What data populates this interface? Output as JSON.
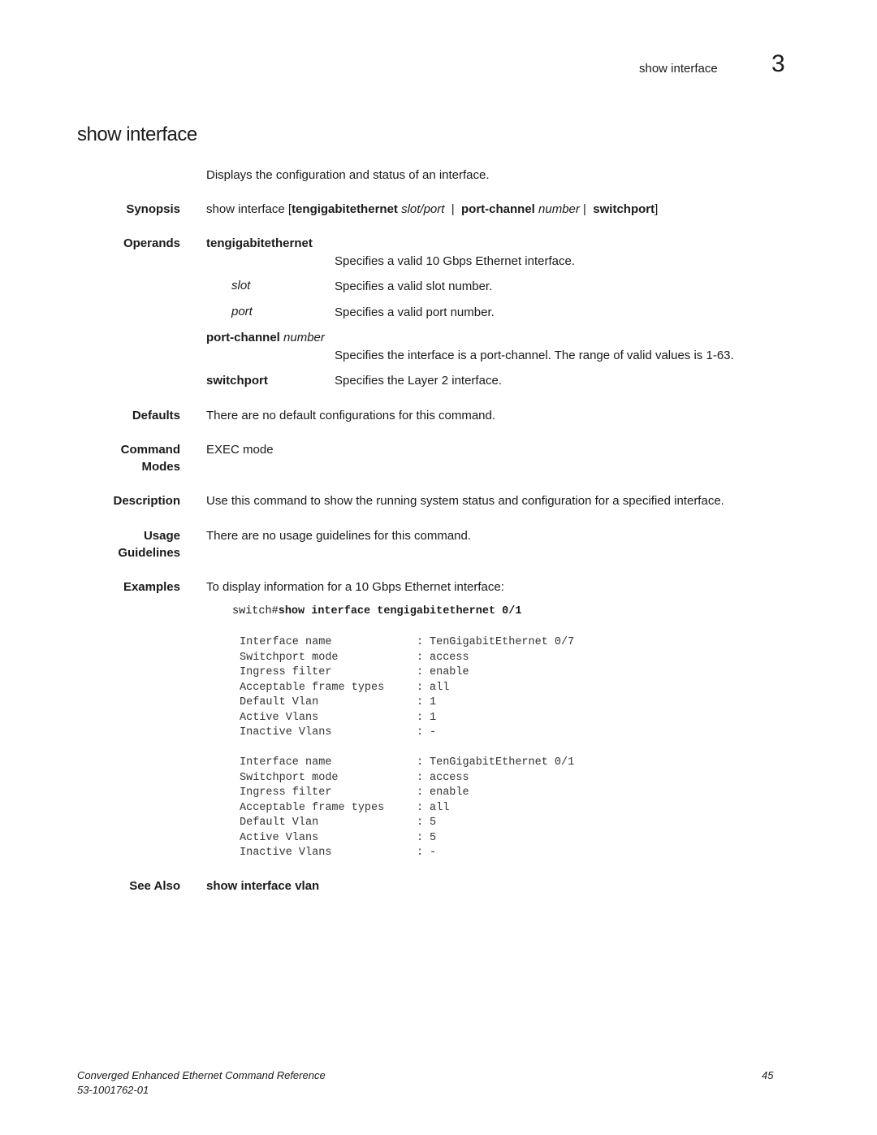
{
  "header": {
    "running_title": "show interface",
    "chapter_number": "3"
  },
  "title": "show interface",
  "intro": "Displays the configuration and status of an interface.",
  "synopsis": {
    "label": "Synopsis",
    "cmd": "show interface",
    "open": " [",
    "opt1": "tengigabitethernet",
    "opt1_arg": " slot/port",
    "sep1": "  |  ",
    "opt2": "port-channel",
    "opt2_arg": " number",
    "sep2": " |  ",
    "opt3": "switchport",
    "close": "]"
  },
  "operands": {
    "label": "Operands",
    "tengig": {
      "name": "tengigabitethernet",
      "desc": "Specifies a valid 10 Gbps Ethernet interface."
    },
    "slot": {
      "name": "slot",
      "desc": "Specifies a valid slot number."
    },
    "port": {
      "name": "port",
      "desc": "Specifies a valid port number."
    },
    "portchannel": {
      "name": "port-channel",
      "arg": " number",
      "desc": "Specifies the interface is a port-channel. The range of valid values is 1-63."
    },
    "switchport": {
      "name": "switchport",
      "desc": "Specifies the Layer 2 interface."
    }
  },
  "defaults": {
    "label": "Defaults",
    "text": "There are no default configurations for this command."
  },
  "command_modes": {
    "label1": "Command",
    "label2": "Modes",
    "text": "EXEC mode"
  },
  "description": {
    "label": "Description",
    "text": "Use this command to show the running system status and configuration for a specified interface."
  },
  "usage": {
    "label1": "Usage",
    "label2": "Guidelines",
    "text": "There are no usage guidelines for this command."
  },
  "examples": {
    "label": "Examples",
    "text": "To display information for a 10 Gbps Ethernet interface:",
    "prompt": "switch#",
    "command": "show interface tengigabitethernet 0/1",
    "blocks": [
      [
        [
          "Interface name",
          ":",
          "TenGigabitEthernet 0/7"
        ],
        [
          "Switchport mode",
          ":",
          "access"
        ],
        [
          "Ingress filter",
          ":",
          "enable"
        ],
        [
          "Acceptable frame types",
          ":",
          "all"
        ],
        [
          "Default Vlan",
          ":",
          "1"
        ],
        [
          "Active Vlans",
          ":",
          "1"
        ],
        [
          "Inactive Vlans",
          ":",
          "-"
        ]
      ],
      [
        [
          "Interface name",
          ":",
          "TenGigabitEthernet 0/1"
        ],
        [
          "Switchport mode",
          ":",
          "access"
        ],
        [
          "Ingress filter",
          ":",
          "enable"
        ],
        [
          "Acceptable frame types",
          ":",
          "all"
        ],
        [
          "Default Vlan",
          ":",
          "5"
        ],
        [
          "Active Vlans",
          ":",
          "5"
        ],
        [
          "Inactive Vlans",
          ":",
          "-"
        ]
      ]
    ]
  },
  "see_also": {
    "label": "See Also",
    "link": "show interface vlan"
  },
  "footer": {
    "book": "Converged Enhanced Ethernet Command Reference",
    "doc_number": "53-1001762-01",
    "page": "45"
  }
}
